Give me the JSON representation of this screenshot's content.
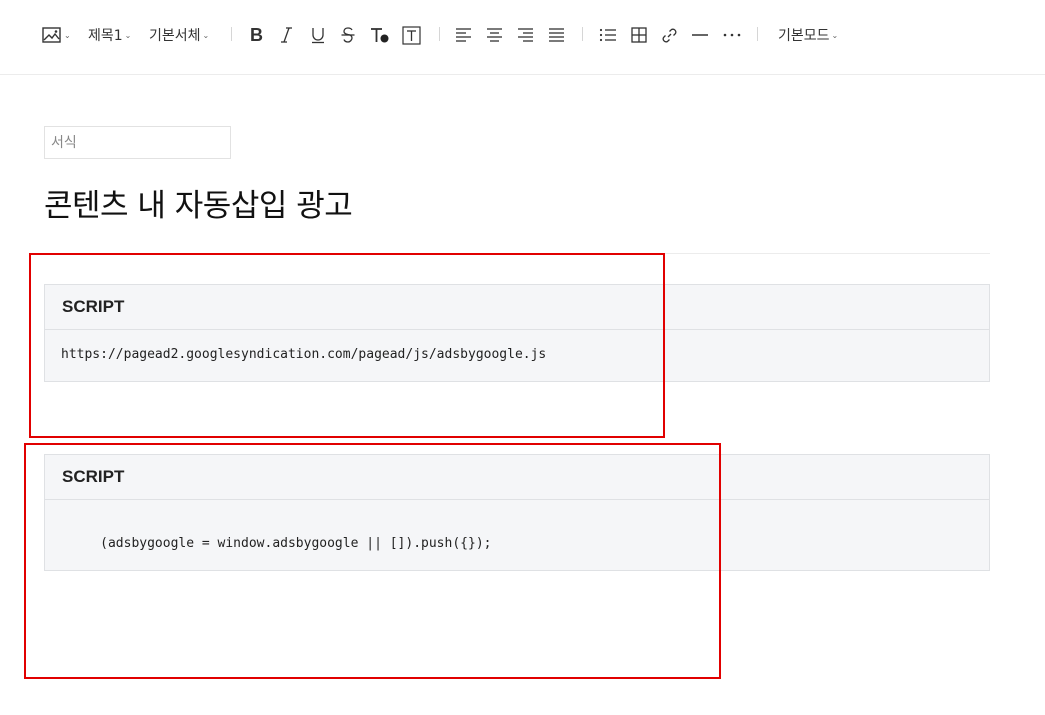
{
  "toolbar": {
    "heading": "제목1",
    "font": "기본서체",
    "mode": "기본모드",
    "buttons": [
      "image",
      "bold",
      "italic",
      "underline",
      "strikethrough",
      "text-color",
      "text-background",
      "align-left",
      "align-center",
      "align-right",
      "align-justify",
      "bulleted-list",
      "table",
      "link",
      "horizontal-rule",
      "more"
    ]
  },
  "editor": {
    "category_placeholder": "서식",
    "title": "콘텐츠 내 자동삽입 광고"
  },
  "blocks": [
    {
      "label": "SCRIPT",
      "code": "https://pagead2.googlesyndication.com/pagead/js/adsbygoogle.js"
    },
    {
      "label": "SCRIPT",
      "code": "     (adsbygoogle = window.adsbygoogle || []).push({});"
    }
  ],
  "colors": {
    "highlight": "#e10000",
    "block_background": "#f5f6f8",
    "block_border": "#dfe1e4"
  }
}
